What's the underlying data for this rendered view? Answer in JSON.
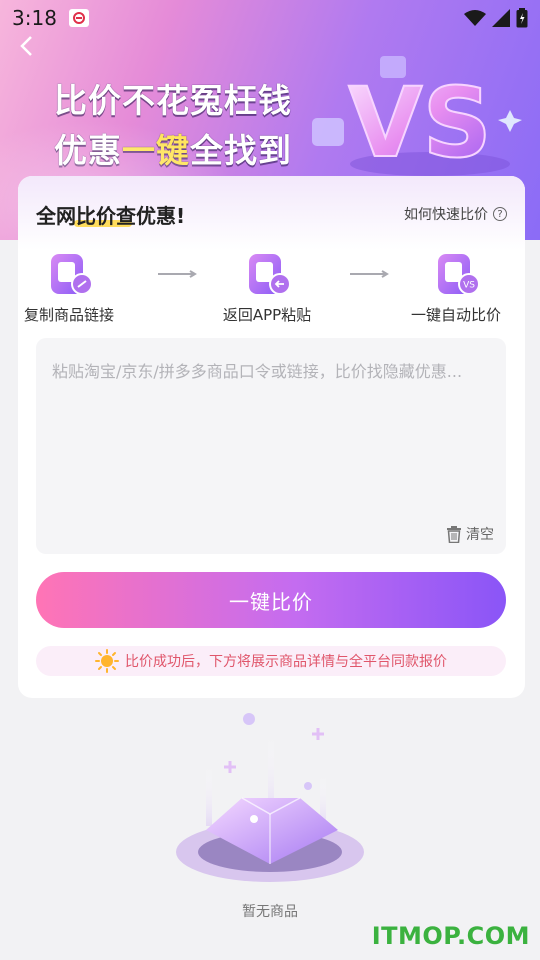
{
  "status_bar": {
    "time": "3:18"
  },
  "hero": {
    "line1": "比价不花冤枉钱",
    "line2_prefix": "优惠",
    "line2_highlight": "一键",
    "line2_suffix": "全找到",
    "vs_text": "VS"
  },
  "card": {
    "title": "全网比价查优惠!",
    "help_label": "如何快速比价",
    "steps": [
      {
        "label": "复制商品链接"
      },
      {
        "label": "返回APP粘贴"
      },
      {
        "label": "一键自动比价"
      }
    ],
    "paste_placeholder": "粘贴淘宝/京东/拼多多商品口令或链接，比价找隐藏优惠...",
    "clear_label": "清空",
    "compare_button": "一键比价",
    "tip": "比价成功后，下方将展示商品详情与全平台同款报价"
  },
  "empty_state": {
    "text": "暂无商品"
  },
  "watermark": "ITMOP.COM",
  "colors": {
    "accent": "#8a55f7",
    "accent_pink": "#ff74b5",
    "highlight_yellow": "#ffe45c",
    "tip_text": "#e0566b"
  }
}
